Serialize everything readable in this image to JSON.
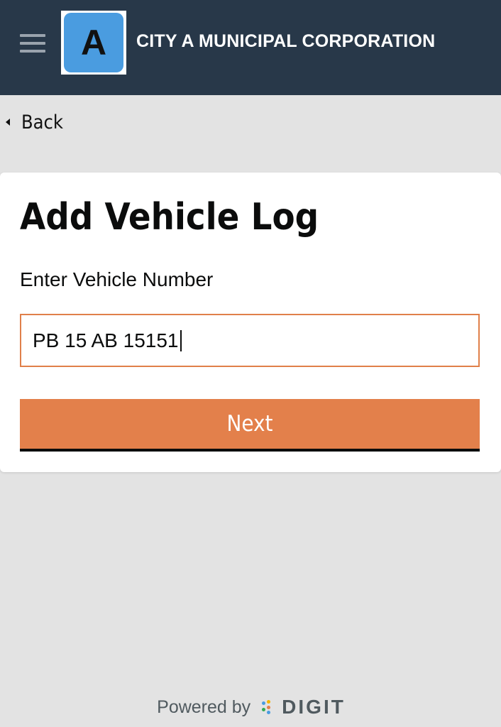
{
  "header": {
    "menu_icon": "hamburger-menu-icon",
    "logo_letter": "A",
    "title": "CITY A MUNICIPAL CORPORATION"
  },
  "back": {
    "icon": "back-arrow-icon",
    "label": "Back"
  },
  "form": {
    "title": "Add Vehicle Log",
    "field_label": "Enter Vehicle Number",
    "vehicle_number_value": "PB 15 AB 15151",
    "next_label": "Next"
  },
  "footer": {
    "powered_by": "Powered by",
    "brand": "DIGIT"
  },
  "colors": {
    "header_bg": "#283849",
    "accent": "#e3804b",
    "page_bg": "#e3e3e3"
  }
}
